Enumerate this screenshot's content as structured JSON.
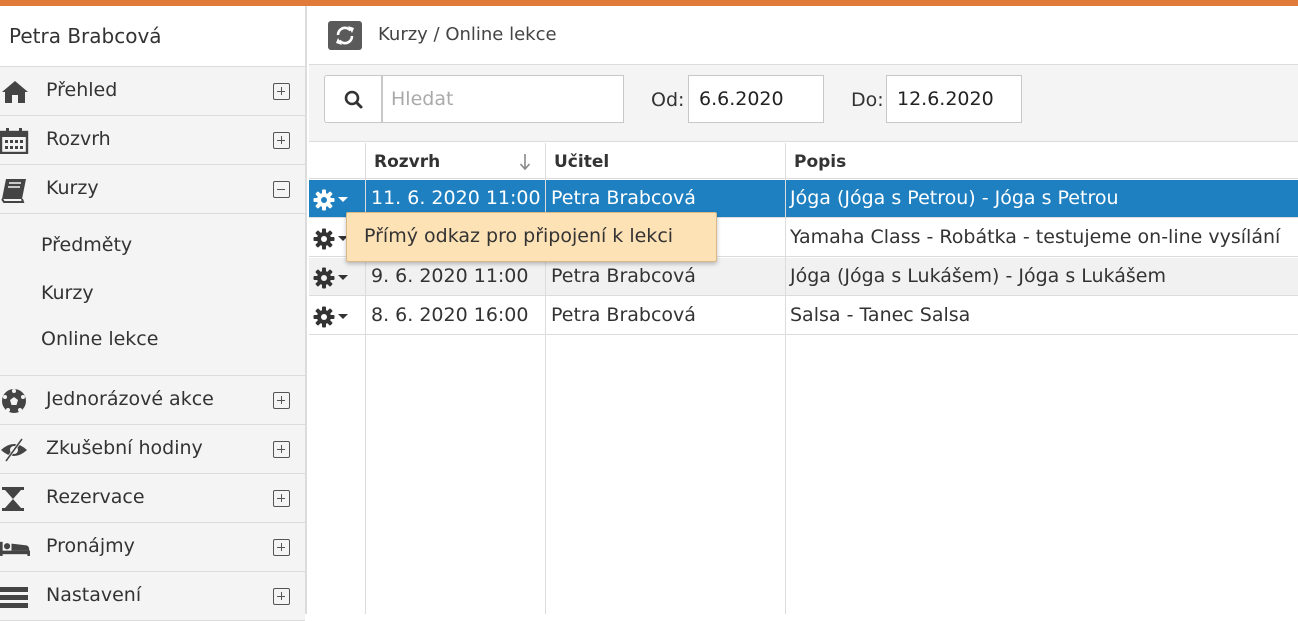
{
  "user": {
    "name": "Petra Brabcová"
  },
  "nav": {
    "items": [
      {
        "label": "Přehled",
        "icon": "home-icon",
        "expanded": false
      },
      {
        "label": "Rozvrh",
        "icon": "calendar-icon",
        "expanded": false
      },
      {
        "label": "Kurzy",
        "icon": "book-icon",
        "expanded": true
      },
      {
        "label": "Jednorázové akce",
        "icon": "soccer-ball-icon",
        "expanded": false
      },
      {
        "label": "Zkušební hodiny",
        "icon": "eye-slash-icon",
        "expanded": false
      },
      {
        "label": "Rezervace",
        "icon": "hourglass-icon",
        "expanded": false
      },
      {
        "label": "Pronájmy",
        "icon": "bed-icon",
        "expanded": false
      },
      {
        "label": "Nastavení",
        "icon": "list-icon",
        "expanded": false
      }
    ],
    "kurzy_sub": [
      "Předměty",
      "Kurzy",
      "Online lekce"
    ]
  },
  "header": {
    "breadcrumb": "Kurzy / Online lekce"
  },
  "filter": {
    "search_placeholder": "Hledat",
    "from_label": "Od:",
    "from_value": "6.6.2020",
    "to_label": "Do:",
    "to_value": "12.6.2020"
  },
  "table": {
    "columns": [
      "Rozvrh",
      "Učitel",
      "Popis"
    ],
    "rows": [
      {
        "rozvrh": "11. 6. 2020 11:00",
        "ucitel": "Petra Brabcová",
        "popis": "Jóga (Jóga s Petrou) - Jóga s Petrou",
        "selected": true
      },
      {
        "rozvrh": "",
        "ucitel": "",
        "popis": "Yamaha Class - Robátka - testujeme on-line vysílání",
        "selected": false
      },
      {
        "rozvrh": "9. 6. 2020 11:00",
        "ucitel": "Petra Brabcová",
        "popis": "Jóga (Jóga s Lukášem) - Jóga s Lukášem",
        "selected": false
      },
      {
        "rozvrh": "8. 6. 2020 16:00",
        "ucitel": "Petra Brabcová",
        "popis": "Salsa - Tanec Salsa",
        "selected": false
      }
    ]
  },
  "tooltip": {
    "text": "Přímý odkaz pro připojení k lekci"
  },
  "colors": {
    "accent": "#e07b39",
    "selected_row": "#1e80c0",
    "tooltip_bg": "#fde2b6"
  }
}
